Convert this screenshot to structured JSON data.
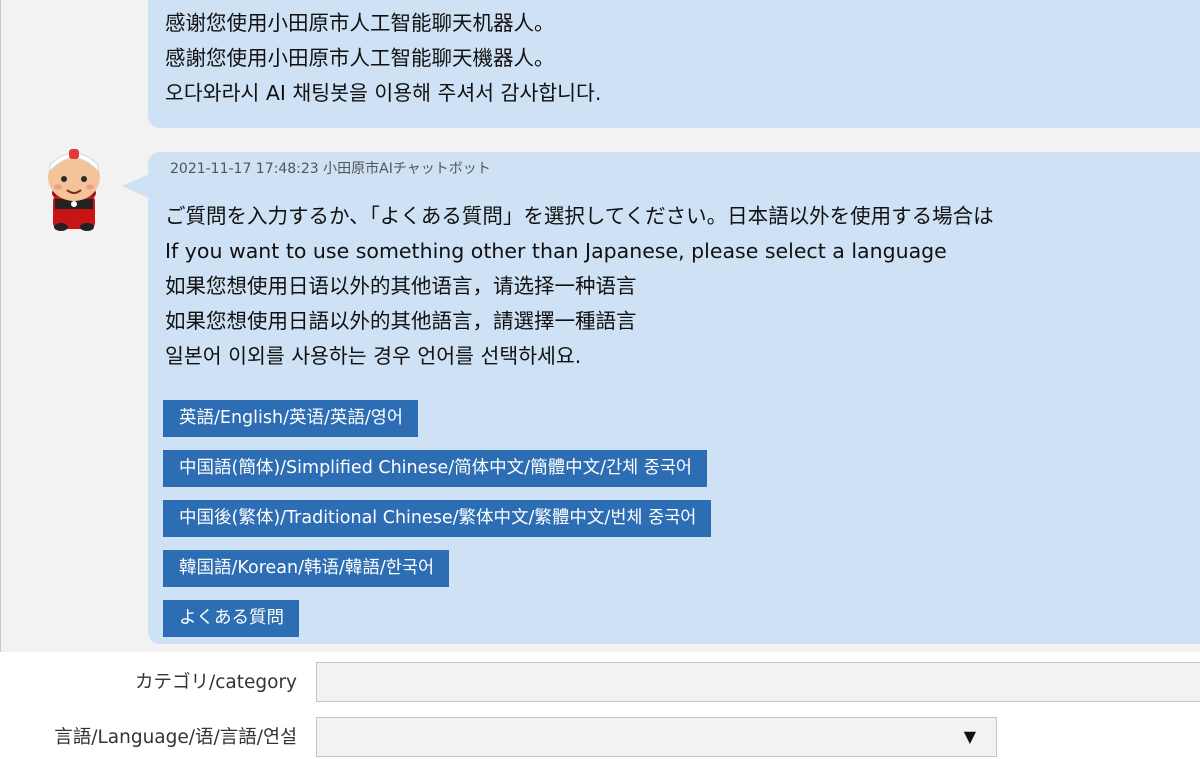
{
  "chat": {
    "previous_message": {
      "lines": [
        "感谢您使用小田原市人工智能聊天机器人。",
        "感謝您使用小田原市人工智能聊天機器人。",
        "오다와라시 AI 채팅봇을 이용해 주셔서 감사합니다."
      ]
    },
    "bot_message": {
      "timestamp": "2021-11-17 17:48:23",
      "sender": "小田原市AIチャットボット",
      "lines": [
        "ご質問を入力するか、「よくある質問」を選択してください。日本語以外を使用する場合は",
        "If you want to use something other than Japanese, please select a language",
        "如果您想使用日语以外的其他语言，请选择一种语言",
        "如果您想使用日語以外的其他語言，請選擇一種語言",
        "일본어 이외를 사용하는 경우 언어를 선택하세요."
      ],
      "options": [
        "英語/English/英语/英語/영어",
        "中国語(簡体)/Simplified Chinese/简体中文/簡體中文/간체 중국어",
        "中国後(繁体)/Traditional Chinese/繁体中文/繁體中文/번체 중국어",
        "韓国語/Korean/韩语/韓語/한국어",
        "よくある質問"
      ]
    },
    "avatar_icon": "mascot-avatar-icon"
  },
  "form": {
    "category_label": "カテゴリ/category",
    "category_value": "",
    "language_label": "言語/Language/语/言語/연설",
    "language_value": "",
    "dropdown_icon": "▼"
  },
  "colors": {
    "bubble": "#cfe1f5",
    "button": "#2c6db4",
    "chat_background": "#f2f2f2"
  }
}
